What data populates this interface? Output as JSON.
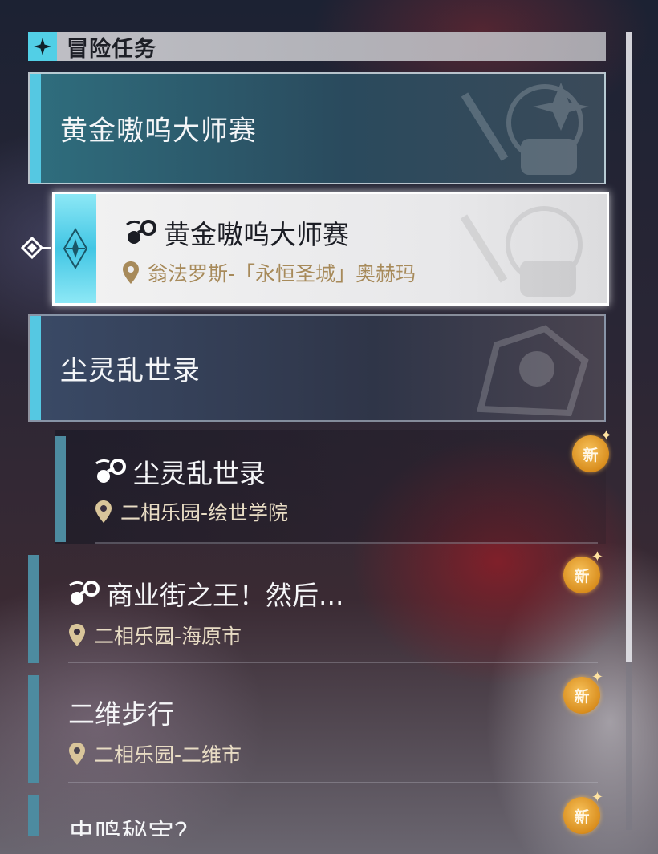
{
  "header": {
    "title": "冒险任务",
    "icon": "diamond-star-icon"
  },
  "groups": [
    {
      "title": "黄金嗷呜大师赛"
    },
    {
      "title": "尘灵乱世录"
    }
  ],
  "selected_quest": {
    "title": "黄金嗷呜大师赛",
    "location": "翁法罗斯-「永恒圣城」奥赫玛",
    "icon": "adventure-quest-icon"
  },
  "quests": [
    {
      "title": "尘灵乱世录",
      "location": "二相乐园-绘世学院",
      "badge": "新",
      "has_type_icon": true
    },
    {
      "title": "商业街之王！然后...",
      "location": "二相乐园-海原市",
      "badge": "新",
      "has_type_icon": true
    },
    {
      "title": "二维步行",
      "location": "二相乐园-二维市",
      "badge": "新",
      "has_type_icon": false
    },
    {
      "title": "虫鸣秘宝？",
      "badge": "新",
      "has_type_icon": false
    }
  ],
  "colors": {
    "accent_cyan": "#55c8e2",
    "badge_gold": "#d98e1e",
    "location_gold": "#a78a5a"
  }
}
